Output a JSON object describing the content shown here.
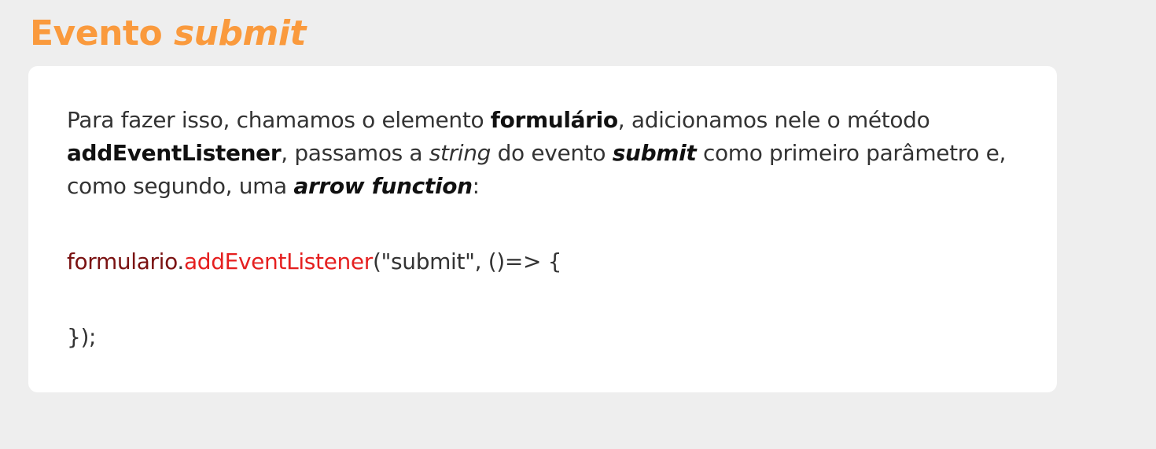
{
  "title": {
    "prefix": "Evento ",
    "emphasis": "submit"
  },
  "paragraph": {
    "t1": "Para fazer isso, chamamos o elemento ",
    "b1": "formulário",
    "t2": ", adicionamos nele o método ",
    "b2": "addEventListener",
    "t3": ", passamos a ",
    "i1": "string",
    "t4": " do evento ",
    "bi1": "submit",
    "t5": " como primeiro parâmetro e, como segundo, uma ",
    "bi2": "arrow function",
    "t6": ":"
  },
  "code": {
    "line1": {
      "object": "formulario",
      "dot": ".",
      "method": "addEventListener",
      "args": "(\"submit\", ()=> {"
    },
    "line2": "});"
  },
  "colors": {
    "title": "#fa9a3d",
    "background": "#eeeeee",
    "card": "#ffffff",
    "code_object": "#7a1212",
    "code_method": "#e51f1f"
  }
}
